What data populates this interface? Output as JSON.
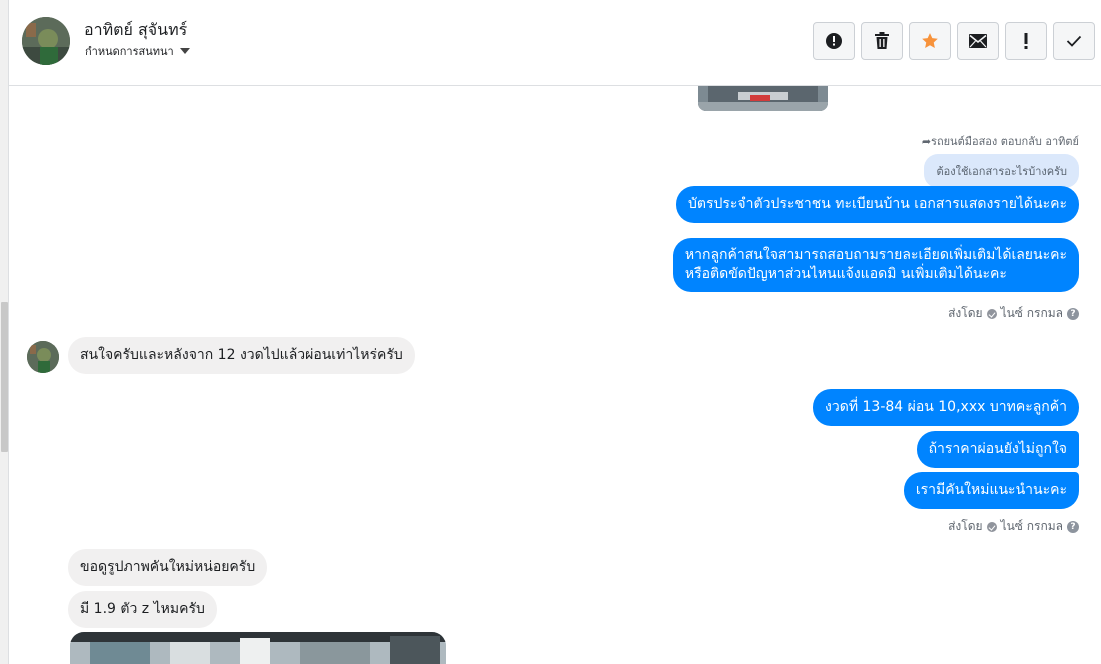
{
  "header": {
    "contact_name": "อาทิตย์ สุจันทร์",
    "chat_settings_label": "กำหนดการสนทนา",
    "actions": [
      {
        "name": "report-button",
        "icon": "alert-circle-icon"
      },
      {
        "name": "delete-button",
        "icon": "trash-icon"
      },
      {
        "name": "star-button",
        "icon": "star-icon"
      },
      {
        "name": "mark-unread-button",
        "icon": "envelope-icon"
      },
      {
        "name": "spam-button",
        "icon": "exclamation-icon"
      },
      {
        "name": "mark-done-button",
        "icon": "checkmark-icon"
      }
    ]
  },
  "conversation": {
    "reply_note": "รถยนต์มือสอง ตอบกลับ อาทิตย์",
    "quoted_text": "ต้องใช้เอกสารอะไรบ้างครับ",
    "out_msg_1": "บัตรประจำตัวประชาชน ทะเบียนบ้าน เอกสารแสดงรายได้นะคะ",
    "out_msg_2_line1": "หากลูกค้าสนใจสามารถสอบถามรายละเอียดเพิ่มเติมได้เลยนะคะ",
    "out_msg_2_line2": "หรือติดขัดปัญหาส่วนไหนแจ้งแอดมิ นเพิ่มเติมได้นะคะ",
    "sent_by_1": {
      "prefix": "ส่งโดย",
      "name": "ไนซ์ กรกมล"
    },
    "in_msg_1": "สนใจครับและหลังจาก 12 งวดไปแล้วผ่อนเท่าไหร่ครับ",
    "out_msg_3": "งวดที่ 13-84 ผ่อน 10,xxx บาทคะลูกค้า",
    "out_msg_4": "ถ้าราคาผ่อนยังไม่ถูกใจ",
    "out_msg_5": "เรามีคันใหม่แนะนำนะคะ",
    "sent_by_2": {
      "prefix": "ส่งโดย",
      "name": "ไนซ์ กรกมล"
    },
    "in_msg_2": "ขอดูรูปภาพคันใหม่หน่อยครับ",
    "in_msg_3": "มี 1.9 ตัว z ไหมครับ"
  },
  "colors": {
    "outgoing_bubble": "#0084ff",
    "incoming_bubble": "#f1f0f0",
    "star": "#f7923b"
  }
}
